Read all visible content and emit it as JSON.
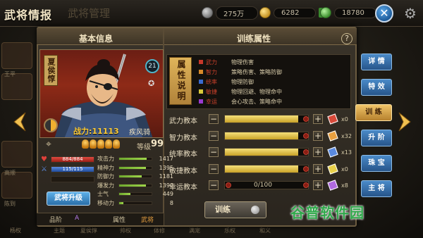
{
  "header": {
    "title": "武将情报",
    "title_shadow": "武将管理",
    "resources": [
      {
        "icon": "silver-coin-icon",
        "value": "275万"
      },
      {
        "icon": "gold-coin-icon",
        "value": "6282"
      },
      {
        "icon": "jade-icon",
        "value": "18780"
      }
    ],
    "close_label": "✕"
  },
  "left_panel": {
    "heading": "基本信息",
    "hero_name": "夏侯惇",
    "level": "21",
    "power": "战力:11113",
    "troop_type": "疾风骑",
    "grade_label": "等级",
    "grade": "99",
    "medals": 5,
    "hp": {
      "label": "884/884",
      "ratio": 1.0
    },
    "troops": {
      "label": "115/115",
      "ratio": 1.0
    },
    "upgrade_button": "武将升级",
    "stats": [
      {
        "label": "攻击力",
        "value": "1417",
        "ratio": 0.85
      },
      {
        "label": "精神力",
        "value": "1395",
        "ratio": 0.83
      },
      {
        "label": "防御力",
        "value": "1181",
        "ratio": 0.7
      },
      {
        "label": "爆发力",
        "value": "1390",
        "ratio": 0.83
      },
      {
        "label": "士气",
        "value": "449",
        "ratio": 0.35
      },
      {
        "label": "移动力",
        "value": "8",
        "ratio": 0.12
      }
    ],
    "quality_label": "品阶",
    "quality": "A",
    "attribute_label": "属性",
    "attribute": "武将"
  },
  "right_panel": {
    "heading": "训练属性",
    "help": "?",
    "attr_title": "属性说明",
    "attr_rows": [
      {
        "name": "武力",
        "desc": "物理伤害",
        "color": "#c8382a"
      },
      {
        "name": "智力",
        "desc": "策略伤害、策略防御",
        "color": "#d88a2a"
      },
      {
        "name": "统率",
        "desc": "物理防御",
        "color": "#3a6ad0"
      },
      {
        "name": "敏捷",
        "desc": "物理回避、物理命中",
        "color": "#d8c83a"
      },
      {
        "name": "幸运",
        "desc": "会心攻击、策略命中",
        "color": "#9a3ad0"
      }
    ],
    "training": [
      {
        "label": "武力教本",
        "ratio": 0.88,
        "count": "x0",
        "icon_color": "#d84a3a"
      },
      {
        "label": "智力教本",
        "ratio": 0.88,
        "count": "x32",
        "icon_color": "#e8a040"
      },
      {
        "label": "统率教本",
        "ratio": 0.88,
        "count": "x13",
        "icon_color": "#5a8ae0"
      },
      {
        "label": "敏捷教本",
        "ratio": 0.88,
        "count": "x0",
        "icon_color": "#e8d04a"
      },
      {
        "label": "幸运教本",
        "ratio": 0.0,
        "count": "x8",
        "text": "0/100",
        "icon_color": "#b06ae0"
      }
    ],
    "train_button": "训练"
  },
  "side_tabs": [
    "详 情",
    "特 效",
    "训 练",
    "升 阶",
    "珠 宝",
    "主 将"
  ],
  "active_tab": 2,
  "ghost_list": [
    "王平",
    "高顺",
    "陈到"
  ],
  "ghost_bottom": [
    "主题",
    "夏侯惇",
    "帅权",
    "体修",
    "满宠",
    "乐权",
    "和义",
    "杨权"
  ],
  "watermark": "谷普软件园"
}
